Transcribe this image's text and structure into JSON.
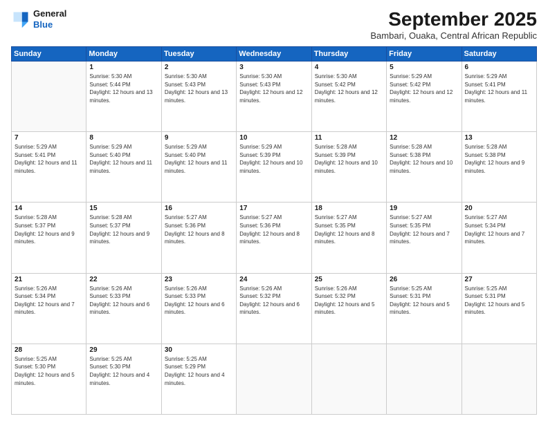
{
  "logo": {
    "line1": "General",
    "line2": "Blue"
  },
  "title": "September 2025",
  "subtitle": "Bambari, Ouaka, Central African Republic",
  "days_header": [
    "Sunday",
    "Monday",
    "Tuesday",
    "Wednesday",
    "Thursday",
    "Friday",
    "Saturday"
  ],
  "weeks": [
    [
      {
        "num": "",
        "sunrise": "",
        "sunset": "",
        "daylight": ""
      },
      {
        "num": "1",
        "sunrise": "5:30 AM",
        "sunset": "5:44 PM",
        "daylight": "12 hours and 13 minutes."
      },
      {
        "num": "2",
        "sunrise": "5:30 AM",
        "sunset": "5:43 PM",
        "daylight": "12 hours and 13 minutes."
      },
      {
        "num": "3",
        "sunrise": "5:30 AM",
        "sunset": "5:43 PM",
        "daylight": "12 hours and 12 minutes."
      },
      {
        "num": "4",
        "sunrise": "5:30 AM",
        "sunset": "5:42 PM",
        "daylight": "12 hours and 12 minutes."
      },
      {
        "num": "5",
        "sunrise": "5:29 AM",
        "sunset": "5:42 PM",
        "daylight": "12 hours and 12 minutes."
      },
      {
        "num": "6",
        "sunrise": "5:29 AM",
        "sunset": "5:41 PM",
        "daylight": "12 hours and 11 minutes."
      }
    ],
    [
      {
        "num": "7",
        "sunrise": "5:29 AM",
        "sunset": "5:41 PM",
        "daylight": "12 hours and 11 minutes."
      },
      {
        "num": "8",
        "sunrise": "5:29 AM",
        "sunset": "5:40 PM",
        "daylight": "12 hours and 11 minutes."
      },
      {
        "num": "9",
        "sunrise": "5:29 AM",
        "sunset": "5:40 PM",
        "daylight": "12 hours and 11 minutes."
      },
      {
        "num": "10",
        "sunrise": "5:29 AM",
        "sunset": "5:39 PM",
        "daylight": "12 hours and 10 minutes."
      },
      {
        "num": "11",
        "sunrise": "5:28 AM",
        "sunset": "5:39 PM",
        "daylight": "12 hours and 10 minutes."
      },
      {
        "num": "12",
        "sunrise": "5:28 AM",
        "sunset": "5:38 PM",
        "daylight": "12 hours and 10 minutes."
      },
      {
        "num": "13",
        "sunrise": "5:28 AM",
        "sunset": "5:38 PM",
        "daylight": "12 hours and 9 minutes."
      }
    ],
    [
      {
        "num": "14",
        "sunrise": "5:28 AM",
        "sunset": "5:37 PM",
        "daylight": "12 hours and 9 minutes."
      },
      {
        "num": "15",
        "sunrise": "5:28 AM",
        "sunset": "5:37 PM",
        "daylight": "12 hours and 9 minutes."
      },
      {
        "num": "16",
        "sunrise": "5:27 AM",
        "sunset": "5:36 PM",
        "daylight": "12 hours and 8 minutes."
      },
      {
        "num": "17",
        "sunrise": "5:27 AM",
        "sunset": "5:36 PM",
        "daylight": "12 hours and 8 minutes."
      },
      {
        "num": "18",
        "sunrise": "5:27 AM",
        "sunset": "5:35 PM",
        "daylight": "12 hours and 8 minutes."
      },
      {
        "num": "19",
        "sunrise": "5:27 AM",
        "sunset": "5:35 PM",
        "daylight": "12 hours and 7 minutes."
      },
      {
        "num": "20",
        "sunrise": "5:27 AM",
        "sunset": "5:34 PM",
        "daylight": "12 hours and 7 minutes."
      }
    ],
    [
      {
        "num": "21",
        "sunrise": "5:26 AM",
        "sunset": "5:34 PM",
        "daylight": "12 hours and 7 minutes."
      },
      {
        "num": "22",
        "sunrise": "5:26 AM",
        "sunset": "5:33 PM",
        "daylight": "12 hours and 6 minutes."
      },
      {
        "num": "23",
        "sunrise": "5:26 AM",
        "sunset": "5:33 PM",
        "daylight": "12 hours and 6 minutes."
      },
      {
        "num": "24",
        "sunrise": "5:26 AM",
        "sunset": "5:32 PM",
        "daylight": "12 hours and 6 minutes."
      },
      {
        "num": "25",
        "sunrise": "5:26 AM",
        "sunset": "5:32 PM",
        "daylight": "12 hours and 5 minutes."
      },
      {
        "num": "26",
        "sunrise": "5:25 AM",
        "sunset": "5:31 PM",
        "daylight": "12 hours and 5 minutes."
      },
      {
        "num": "27",
        "sunrise": "5:25 AM",
        "sunset": "5:31 PM",
        "daylight": "12 hours and 5 minutes."
      }
    ],
    [
      {
        "num": "28",
        "sunrise": "5:25 AM",
        "sunset": "5:30 PM",
        "daylight": "12 hours and 5 minutes."
      },
      {
        "num": "29",
        "sunrise": "5:25 AM",
        "sunset": "5:30 PM",
        "daylight": "12 hours and 4 minutes."
      },
      {
        "num": "30",
        "sunrise": "5:25 AM",
        "sunset": "5:29 PM",
        "daylight": "12 hours and 4 minutes."
      },
      {
        "num": "",
        "sunrise": "",
        "sunset": "",
        "daylight": ""
      },
      {
        "num": "",
        "sunrise": "",
        "sunset": "",
        "daylight": ""
      },
      {
        "num": "",
        "sunrise": "",
        "sunset": "",
        "daylight": ""
      },
      {
        "num": "",
        "sunrise": "",
        "sunset": "",
        "daylight": ""
      }
    ]
  ]
}
